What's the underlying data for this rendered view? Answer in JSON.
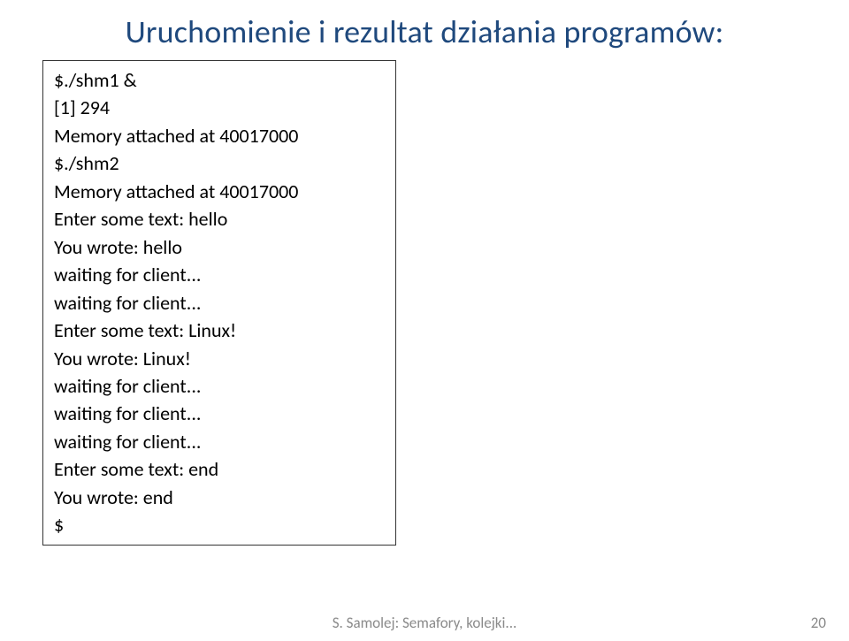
{
  "title": "Uruchomienie i rezultat działania programów:",
  "terminal": {
    "lines": [
      "$./shm1 &",
      "[1] 294",
      "Memory attached at 40017000",
      "$./shm2",
      "Memory attached at 40017000",
      "Enter some text: hello",
      "You wrote: hello",
      "waiting for client...",
      "waiting for client...",
      "Enter some text: Linux!",
      "You wrote: Linux!",
      "waiting for client...",
      "waiting for client...",
      "waiting for client...",
      "Enter some text: end",
      "You wrote: end",
      "$"
    ]
  },
  "footer": "S. Samolej: Semafory, kolejki...",
  "page_number": "20"
}
